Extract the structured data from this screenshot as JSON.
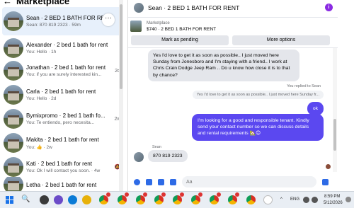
{
  "left_panel": {
    "title": "Marketplace",
    "back_glyph": "←",
    "more_glyph": "···",
    "conversations": [
      {
        "title": "Sean · 2 BED 1 BATH FOR RENT",
        "sub": "Sean: 870 819 2323 · 59m",
        "indicator": ""
      },
      {
        "title": "Alexander · 2 bed 1 bath for rent",
        "sub": "You: Hello · 1h",
        "indicator": ""
      },
      {
        "title": "Jonathan · 2 bed 1 bath for rent",
        "sub": "You: if you are surely interested kin...",
        "indicator": "2d"
      },
      {
        "title": "Carla · 2 bed 1 bath for rent",
        "sub": "You: Hello · 2d",
        "indicator": ""
      },
      {
        "title": "Bymixpromo · 2 bed 1 bath fo...",
        "sub": "You: Te entiendo, pero necesita...",
        "indicator": "2w"
      },
      {
        "title": "Makita · 2 bed 1 bath for rent",
        "sub": "You: 👍 · 2w",
        "indicator": ""
      },
      {
        "title": "Kati · 2 bed 1 bath for rent",
        "sub": "You: Ok I will contact you soon. · 4w",
        "indicator": ""
      },
      {
        "title": "Letha · 2 bed 1 bath for rent",
        "sub": "",
        "indicator": ""
      }
    ]
  },
  "chat": {
    "header_title": "Sean · 2 BED 1 BATH FOR RENT",
    "info_glyph": "i",
    "listing_source": "Marketplace",
    "listing_line": "$740 · 2 BED 1 BATH FOR RENT",
    "mark_pending_label": "Mark as pending",
    "more_options_label": "More options",
    "incoming_message": "Yes I'd love to get it as soon as possible.. I just moved here Sunday from Jonesboro and I'm staying with a friend.. I work at Chris Crain Dodge Jeep Ram .. Do u know how close it is to that by chance?",
    "reply_label": "You replied to Sean",
    "reply_quote": "Yes I'd love to get it as soon as possible.. I just moved here Sunday fr...",
    "ok_message": "ok",
    "outgoing_message": "I'm looking for a good and responsible tenant. Kindly send your contact number so we can discuss details and rental requirements 🏡😊",
    "sender_label": "Sean",
    "phone_message": "870 819 2323",
    "input_placeholder": "Aa"
  },
  "taskbar": {
    "search_glyph": "🔍",
    "tray_chevron": "^",
    "language": "ENG",
    "time": "8:59 PM",
    "date": "5/12/2026"
  }
}
